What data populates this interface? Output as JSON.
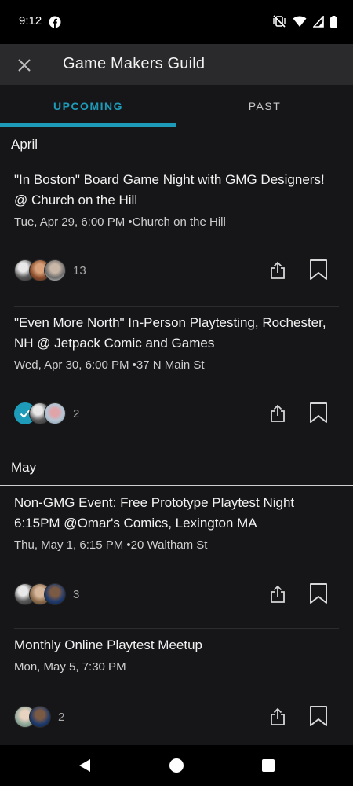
{
  "status_bar": {
    "time": "9:12"
  },
  "app_bar": {
    "title": "Game Makers Guild"
  },
  "tabs": [
    {
      "label": "UPCOMING",
      "active": true
    },
    {
      "label": "PAST",
      "active": false
    }
  ],
  "sections": [
    {
      "month": "April",
      "events": [
        {
          "title": "\"In Boston\" Board Game Night with GMG Designers! @ Church on the Hill",
          "meta": "Tue, Apr 29, 6:00 PM •Church on the Hill",
          "attendee_count": "13",
          "rsvp_checked": false
        },
        {
          "title": "\"Even More North\" In-Person Playtesting, Rochester, NH @ Jetpack Comic and Games",
          "meta": "Wed, Apr 30, 6:00 PM •37 N Main St",
          "attendee_count": "2",
          "rsvp_checked": true
        }
      ]
    },
    {
      "month": "May",
      "events": [
        {
          "title": "Non-GMG Event: Free Prototype Playtest Night 6:15PM @Omar's Comics, Lexington MA",
          "meta": "Thu, May 1, 6:15 PM •20 Waltham St",
          "attendee_count": "3",
          "rsvp_checked": false
        },
        {
          "title": "Monthly Online Playtest Meetup",
          "meta": "Mon, May 5, 7:30 PM",
          "attendee_count": "2",
          "rsvp_checked": false
        }
      ]
    }
  ],
  "colors": {
    "accent": "#1e9bb8",
    "background": "#161618",
    "app_bar": "#2a2a2c"
  },
  "icons": {
    "close": "close-icon",
    "share": "share-icon",
    "bookmark": "bookmark-icon",
    "check": "check-icon",
    "nav_back": "back-triangle-icon",
    "nav_home": "home-circle-icon",
    "nav_recents": "recents-square-icon"
  }
}
